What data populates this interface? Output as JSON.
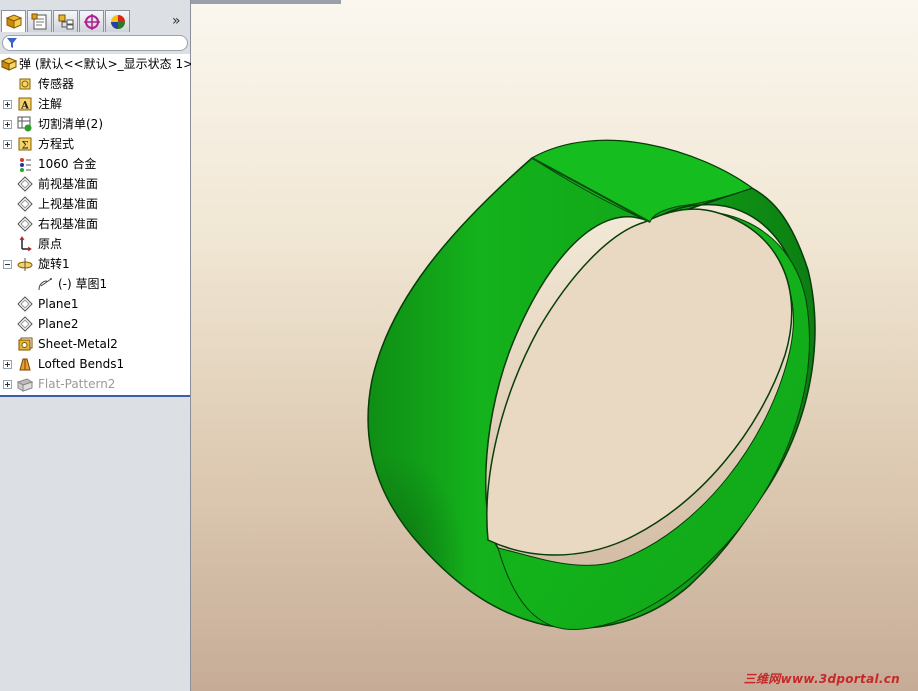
{
  "feature_manager": {
    "tabs": [
      {
        "name": "feature-manager-tab",
        "icon": "feature-tree-icon"
      },
      {
        "name": "property-manager-tab",
        "icon": "property-manager-icon"
      },
      {
        "name": "configuration-manager-tab",
        "icon": "configuration-manager-icon"
      },
      {
        "name": "dimxpert-manager-tab",
        "icon": "crosshair-icon"
      },
      {
        "name": "display-manager-tab",
        "icon": "appearance-icon"
      }
    ],
    "more_label": "»",
    "root": "弹  (默认<<默认>_显示状态 1>",
    "items": [
      {
        "label": "传感器",
        "icon": "sensor-icon",
        "expander": "none"
      },
      {
        "label": "注解",
        "icon": "annotation-icon",
        "expander": "plus"
      },
      {
        "label": "切割清单(2)",
        "icon": "cut-list-icon",
        "expander": "plus"
      },
      {
        "label": "方程式",
        "icon": "equation-icon",
        "expander": "plus"
      },
      {
        "label": "1060 合金",
        "icon": "material-icon",
        "expander": "none"
      },
      {
        "label": "前视基准面",
        "icon": "plane-icon",
        "expander": "none"
      },
      {
        "label": "上视基准面",
        "icon": "plane-icon",
        "expander": "none"
      },
      {
        "label": "右视基准面",
        "icon": "plane-icon",
        "expander": "none"
      },
      {
        "label": "原点",
        "icon": "origin-icon",
        "expander": "none"
      },
      {
        "label": "旋转1",
        "icon": "revolve-icon",
        "expander": "minus"
      },
      {
        "label": "(-) 草图1",
        "icon": "sketch-icon",
        "expander": "none",
        "child": true
      },
      {
        "label": "Plane1",
        "icon": "plane-icon",
        "expander": "none"
      },
      {
        "label": "Plane2",
        "icon": "plane-icon",
        "expander": "none"
      },
      {
        "label": "Sheet-Metal2",
        "icon": "sheet-metal-icon",
        "expander": "none"
      },
      {
        "label": "Lofted Bends1",
        "icon": "lofted-bend-icon",
        "expander": "plus"
      },
      {
        "label": "Flat-Pattern2",
        "icon": "flat-pattern-icon",
        "expander": "plus",
        "suppressed": true
      }
    ]
  },
  "graphics": {
    "model_color": "#12b81c",
    "watermark": "三维网www.3dportal.cn"
  }
}
